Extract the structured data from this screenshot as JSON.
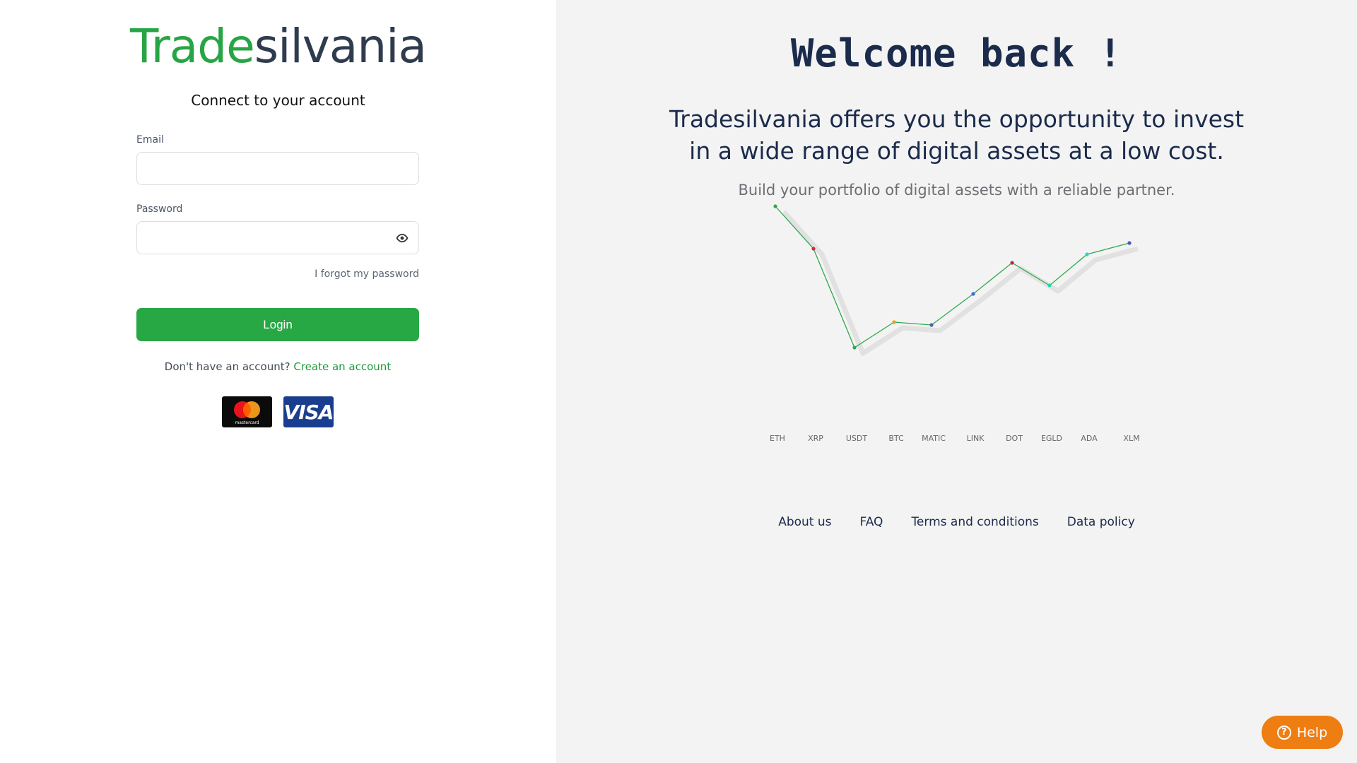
{
  "brand": {
    "part1": "Trade",
    "part2": "silvania",
    "accent": "#27a544",
    "dark": "#2f3b4e"
  },
  "login": {
    "subtitle": "Connect to your account",
    "email_label": "Email",
    "email_value": "",
    "password_label": "Password",
    "password_value": "",
    "forgot": "I forgot my password",
    "button": "Login",
    "no_account": "Don't have an account?",
    "create": "Create an account"
  },
  "cards": {
    "mastercard_text": "mastercard",
    "visa_text": "VISA"
  },
  "hero": {
    "welcome": "Welcome back !",
    "headline_1": "Tradesilvania offers you the opportunity to invest",
    "headline_2": "in a wide range of digital assets at a low cost.",
    "tagline": "Build your portfolio of digital assets with a reliable partner."
  },
  "chart_data": {
    "type": "line",
    "categories": [
      "ETH",
      "XRP",
      "USDT",
      "BTC",
      "MATIC",
      "LINK",
      "DOT",
      "EGLD",
      "ADA",
      "XLM"
    ],
    "values": [
      9.1,
      7.6,
      4.1,
      5.0,
      4.9,
      6.0,
      7.1,
      6.3,
      7.4,
      7.8
    ],
    "ylim": [
      0,
      10
    ],
    "point_colors": [
      "#2eaa4a",
      "#e0233a",
      "#2eaa4a",
      "#e8a020",
      "#5a5aa8",
      "#3c6ad8",
      "#c0245a",
      "#2ed3a6",
      "#2ed3c0",
      "#4a52c8"
    ],
    "line_color": "#2eaa4a"
  },
  "footer": {
    "about": "About us",
    "faq": "FAQ",
    "terms": "Terms and conditions",
    "data_policy": "Data policy"
  },
  "help": {
    "label": "Help",
    "color": "#ee7d12"
  }
}
